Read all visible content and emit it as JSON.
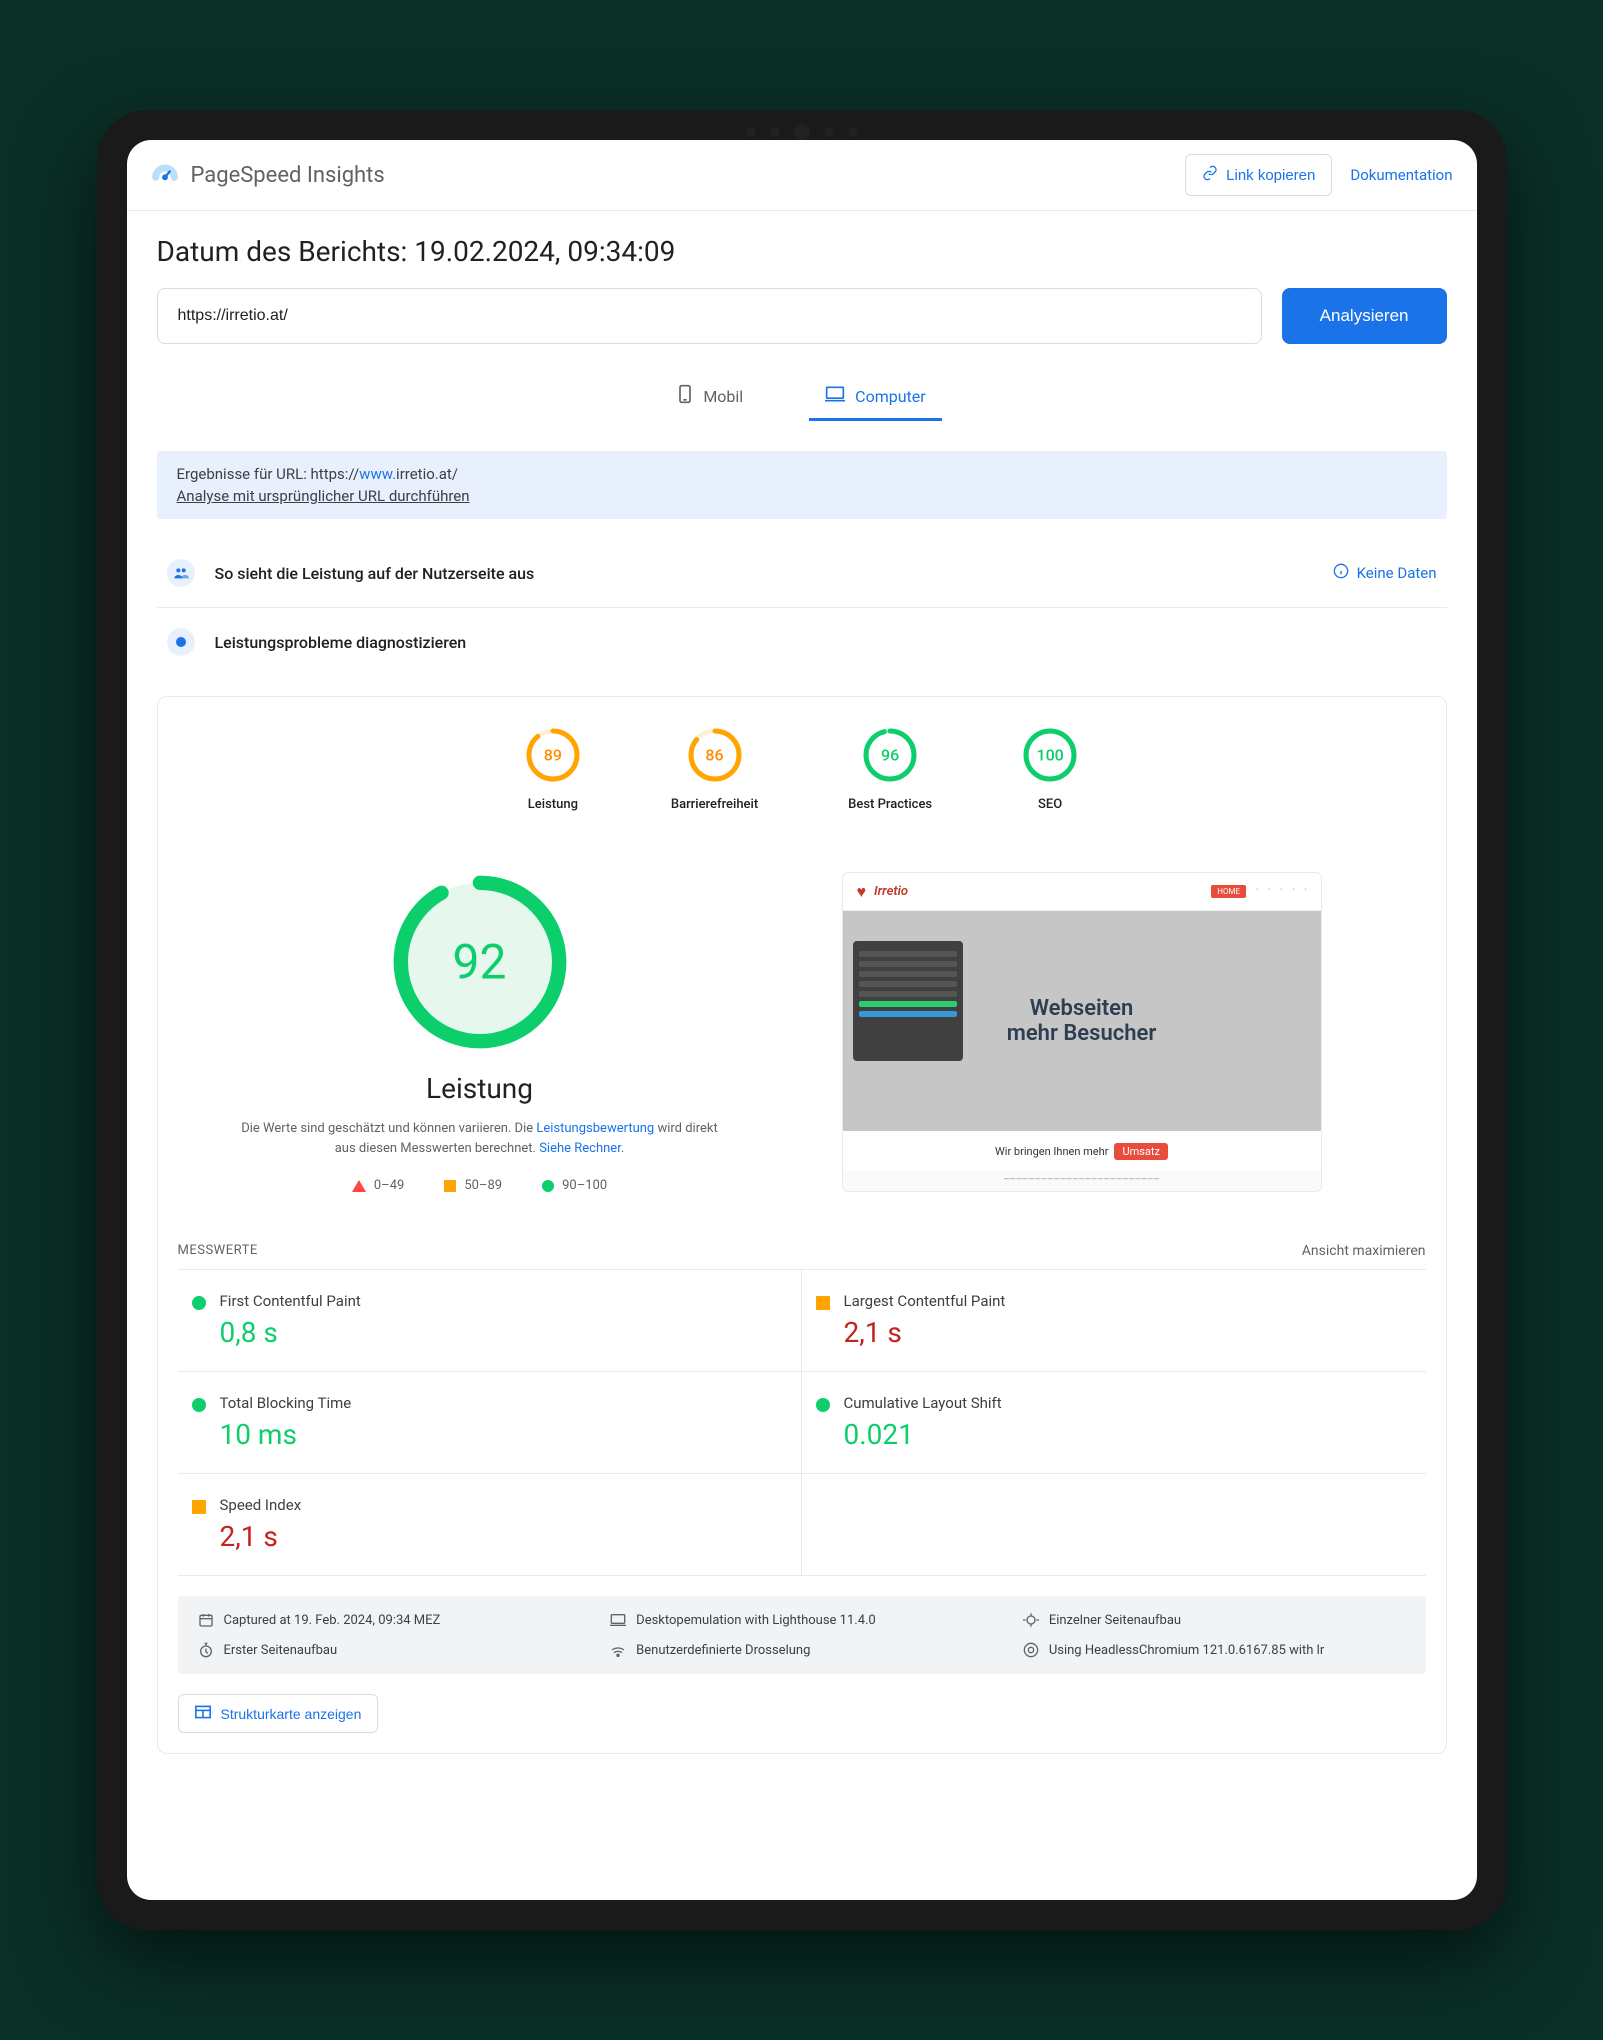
{
  "header": {
    "app_title": "PageSpeed Insights",
    "link_copy": "Link kopieren",
    "documentation": "Dokumentation"
  },
  "report_title": "Datum des Berichts: 19.02.2024, 09:34:09",
  "url_input": "https://irretio.at/",
  "analyze_btn": "Analysieren",
  "tabs": {
    "mobile": "Mobil",
    "desktop": "Computer"
  },
  "results_banner": {
    "prefix": "Ergebnisse für URL: https://",
    "highlight": "www.",
    "suffix": "irretio.at/",
    "rerun": "Analyse mit ursprünglicher URL durchführen"
  },
  "ux_section": {
    "title": "So sieht die Leistung auf der Nutzerseite aus",
    "no_data": "Keine Daten"
  },
  "diagnose_title": "Leistungsprobleme diagnostizieren",
  "scores": [
    {
      "label": "Leistung",
      "value": "89",
      "color": "orange",
      "pct": 89
    },
    {
      "label": "Barrierefreiheit",
      "value": "86",
      "color": "orange",
      "pct": 86
    },
    {
      "label": "Best Practices",
      "value": "96",
      "color": "green",
      "pct": 96
    },
    {
      "label": "SEO",
      "value": "100",
      "color": "green",
      "pct": 100
    }
  ],
  "big_score": {
    "value": "92",
    "label": "Leistung",
    "pct": 92
  },
  "perf_desc_1": "Die Werte sind geschätzt und können variieren. Die ",
  "perf_desc_link1": "Leistungsbewertung",
  "perf_desc_2": " wird direkt aus diesen Messwerten berechnet. ",
  "perf_desc_link2": "Siehe Rechner",
  "legend": {
    "r0": "0–49",
    "r1": "50–89",
    "r2": "90–100"
  },
  "preview": {
    "logo": "Irretio",
    "hero1": "Webseiten",
    "hero2": "mehr Besucher",
    "cta_prefix": "Wir bringen Ihnen mehr",
    "cta_highlight": "Umsatz"
  },
  "metrics_label": "MESSWERTE",
  "maximize": "Ansicht maximieren",
  "metrics": [
    {
      "name": "First Contentful Paint",
      "value": "0,8 s",
      "ind": "green",
      "vclass": "green"
    },
    {
      "name": "Largest Contentful Paint",
      "value": "2,1 s",
      "ind": "orange",
      "vclass": "red"
    },
    {
      "name": "Total Blocking Time",
      "value": "10 ms",
      "ind": "green",
      "vclass": "green"
    },
    {
      "name": "Cumulative Layout Shift",
      "value": "0.021",
      "ind": "green",
      "vclass": "green"
    },
    {
      "name": "Speed Index",
      "value": "2,1 s",
      "ind": "orange",
      "vclass": "red"
    }
  ],
  "capture": [
    "Captured at 19. Feb. 2024, 09:34 MEZ",
    "Desktopemulation with Lighthouse 11.4.0",
    "Einzelner Seitenaufbau",
    "Erster Seitenaufbau",
    "Benutzerdefinierte Drosselung",
    "Using HeadlessChromium 121.0.6167.85 with lr"
  ],
  "treemap": "Strukturkarte anzeigen"
}
